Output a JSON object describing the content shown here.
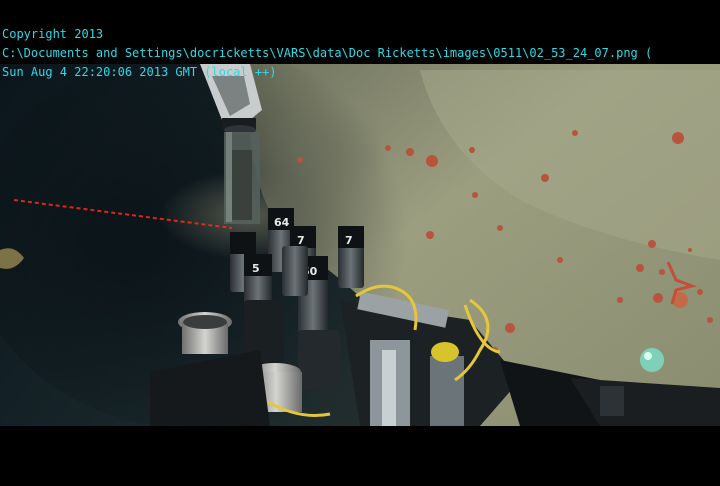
{
  "overlay": {
    "copyright": "Copyright 2013",
    "file_path": "C:\\Documents and Settings\\docricketts\\VARS\\data\\Doc Ricketts\\images\\0511\\02_53_24_07.png (",
    "timestamp": "Sun Aug 4 22:20:06 2013 GMT (local ++)",
    "text_color": "#2fd9e6"
  },
  "scene": {
    "sample_tube_labels": [
      "64",
      "7",
      "7",
      "5",
      "50"
    ],
    "colors": {
      "letterbox": "#000000",
      "water": "#0d1a22",
      "sediment": "#8c8f74",
      "sediment_light": "#a3a587",
      "laser": "#ff2a1a",
      "cable_yellow": "#e6c63a",
      "urchin": "#b8543e"
    }
  }
}
